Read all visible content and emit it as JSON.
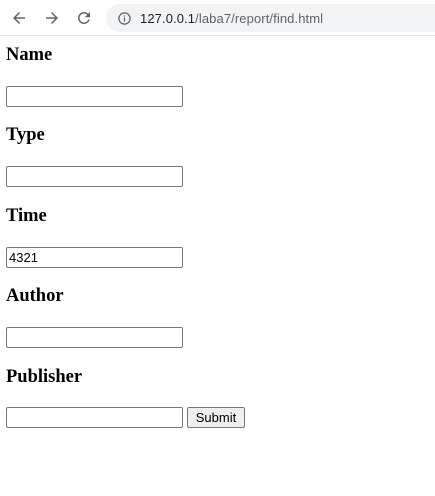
{
  "browser": {
    "url_host": "127.0.0.1",
    "url_path": "/laba7/report/find.html",
    "icons": {
      "back": "arrow-left-icon",
      "forward": "arrow-right-icon",
      "reload": "reload-icon",
      "info": "info-icon"
    }
  },
  "form": {
    "fields": [
      {
        "label": "Name",
        "value": ""
      },
      {
        "label": "Type",
        "value": ""
      },
      {
        "label": "Time",
        "value": "4321"
      },
      {
        "label": "Author",
        "value": ""
      },
      {
        "label": "Publisher",
        "value": ""
      }
    ],
    "submit_label": "Submit"
  }
}
